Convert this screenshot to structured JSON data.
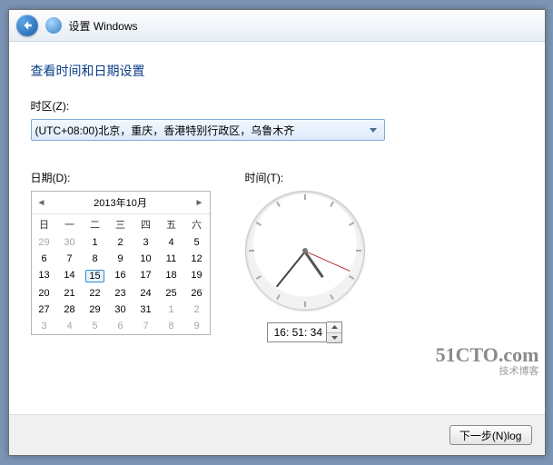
{
  "header": {
    "title": "设置 Windows"
  },
  "page": {
    "title": "查看时间和日期设置",
    "tz_label": "时区(Z):",
    "tz_value": "(UTC+08:00)北京，重庆，香港特别行政区，乌鲁木齐",
    "date_label": "日期(D):",
    "time_label": "时间(T):",
    "next_label": "下一步(N)log"
  },
  "calendar": {
    "title": "2013年10月",
    "dow": [
      "日",
      "一",
      "二",
      "三",
      "四",
      "五",
      "六"
    ],
    "cells": [
      {
        "n": 29,
        "o": true
      },
      {
        "n": 30,
        "o": true
      },
      {
        "n": 1
      },
      {
        "n": 2
      },
      {
        "n": 3
      },
      {
        "n": 4
      },
      {
        "n": 5
      },
      {
        "n": 6
      },
      {
        "n": 7
      },
      {
        "n": 8
      },
      {
        "n": 9
      },
      {
        "n": 10
      },
      {
        "n": 11
      },
      {
        "n": 12
      },
      {
        "n": 13
      },
      {
        "n": 14
      },
      {
        "n": 15,
        "sel": true
      },
      {
        "n": 16
      },
      {
        "n": 17
      },
      {
        "n": 18
      },
      {
        "n": 19
      },
      {
        "n": 20
      },
      {
        "n": 21
      },
      {
        "n": 22
      },
      {
        "n": 23
      },
      {
        "n": 24
      },
      {
        "n": 25
      },
      {
        "n": 26
      },
      {
        "n": 27
      },
      {
        "n": 28
      },
      {
        "n": 29
      },
      {
        "n": 30
      },
      {
        "n": 31
      },
      {
        "n": 1,
        "o": true
      },
      {
        "n": 2,
        "o": true
      },
      {
        "n": 3,
        "o": true
      },
      {
        "n": 4,
        "o": true
      },
      {
        "n": 5,
        "o": true
      },
      {
        "n": 6,
        "o": true
      },
      {
        "n": 7,
        "o": true
      },
      {
        "n": 8,
        "o": true
      },
      {
        "n": 9,
        "o": true
      }
    ]
  },
  "clock": {
    "time_text": "16: 51: 34",
    "hour_deg": 145,
    "minute_deg": 219,
    "second_deg": 114
  },
  "watermark": {
    "big": "51CTO.com",
    "small": "技术博客"
  }
}
